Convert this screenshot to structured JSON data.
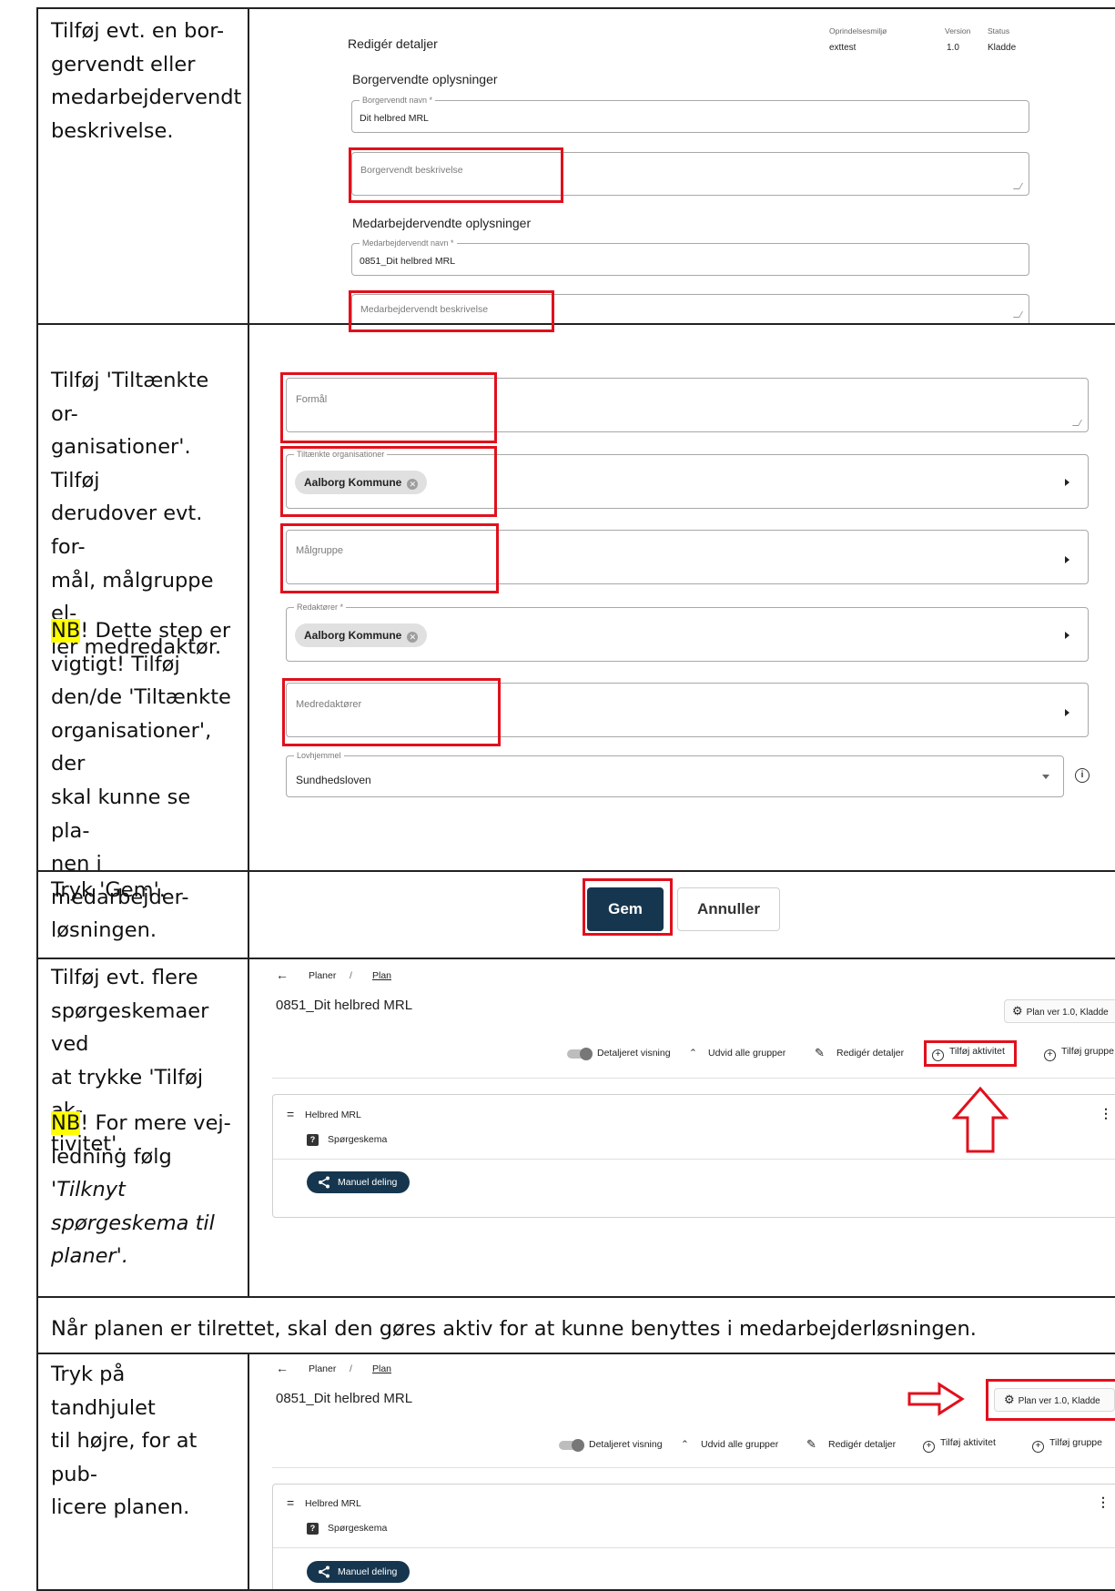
{
  "rows": [
    {
      "instruction_lines": [
        "Tilføj evt. en bor-",
        "gervendt eller",
        "medarbejdervendt",
        "beskrivelse."
      ]
    },
    {
      "instruction_lines": [
        "Tilføj 'Tiltænkte or-",
        "ganisationer'. Tilføj",
        "derudover evt. for-",
        "mål, målgruppe el-",
        "ler medredaktør."
      ],
      "note_highlight": "NB",
      "note_lines": [
        "! Dette step er",
        "vigtigt! Tilføj",
        "den/de 'Tiltænkte",
        "organisationer', der",
        "skal kunne se pla-",
        "nen i medarbejder-",
        "løsningen."
      ]
    },
    {
      "instruction_lines": [
        "Tryk 'Gem'."
      ]
    },
    {
      "instruction_lines": [
        "Tilføj evt. flere",
        "spørgeskemaer ved",
        "at trykke 'Tilføj ak-",
        "tivitet'."
      ],
      "note_highlight": "NB",
      "note_first": "! For mere vej-",
      "note_second": "ledning følg '",
      "note_italic_lines": [
        "Tilknyt",
        "spørgeskema til",
        "planer'."
      ]
    },
    {
      "full_text": "Når planen er tilrettet, skal den gøres aktiv for at kunne benyttes i medarbejderløsningen."
    },
    {
      "instruction_lines": [
        "Tryk på tandhjulet",
        "til højre, for at pub-",
        "licere planen."
      ]
    }
  ],
  "edit_details": {
    "title": "Redigér detaljer",
    "meta_headers": [
      "Oprindelsesmiljø",
      "Version",
      "Status"
    ],
    "meta_values": [
      "exttest",
      "1.0",
      "Kladde"
    ],
    "citizen_section": "Borgervendte oplysninger",
    "citizen_name_label": "Borgervendt navn *",
    "citizen_name_value": "Dit helbred MRL",
    "citizen_description_placeholder": "Borgervendt beskrivelse",
    "staff_section": "Medarbejdervendte oplysninger",
    "staff_name_label": "Medarbejdervendt navn *",
    "staff_name_value": "0851_Dit helbred MRL",
    "staff_description_placeholder": "Medarbejdervendt beskrivelse"
  },
  "org_form": {
    "purpose_placeholder": "Formål",
    "intended_orgs_label": "Tiltænkte organisationer",
    "intended_orgs_chip": "Aalborg Kommune",
    "target_group_placeholder": "Målgruppe",
    "editors_label": "Redaktører *",
    "editors_chip": "Aalborg Kommune",
    "co_editors_placeholder": "Medredaktører",
    "legal_basis_label": "Lovhjemmel",
    "legal_basis_value": "Sundhedsloven",
    "info_icon_glyph": "i",
    "chip_remove_glyph": "✕"
  },
  "save_buttons": {
    "save": "Gem",
    "cancel": "Annuller"
  },
  "plan_view": {
    "back_arrow": "←",
    "breadcrumb_root": "Planer",
    "breadcrumb_sep": "/",
    "breadcrumb_current": "Plan",
    "plan_title": "0851_Dit helbred MRL",
    "plan_version_button": "Plan ver 1.0, Kladde",
    "gear_glyph": "⚙",
    "toolbar": {
      "detailed_view": "Detaljeret visning",
      "expand_all": "Udvid alle grupper",
      "edit_details": "Redigér detaljer",
      "add_activity": "Tilføj aktivitet",
      "add_group": "Tilføj gruppe",
      "expand_glyph": "⌃",
      "edit_glyph": "✎",
      "add_glyph": "+"
    },
    "group_name": "Helbred MRL",
    "activity_name": "Spørgeskema",
    "share_button": "Manuel deling",
    "menu_glyph": "⋮",
    "drag_glyph": "=",
    "question_glyph": "?"
  },
  "colors": {
    "highlight_red": "#e1101c",
    "primary_dark": "#16364f",
    "note_highlight": "#ffff00"
  }
}
